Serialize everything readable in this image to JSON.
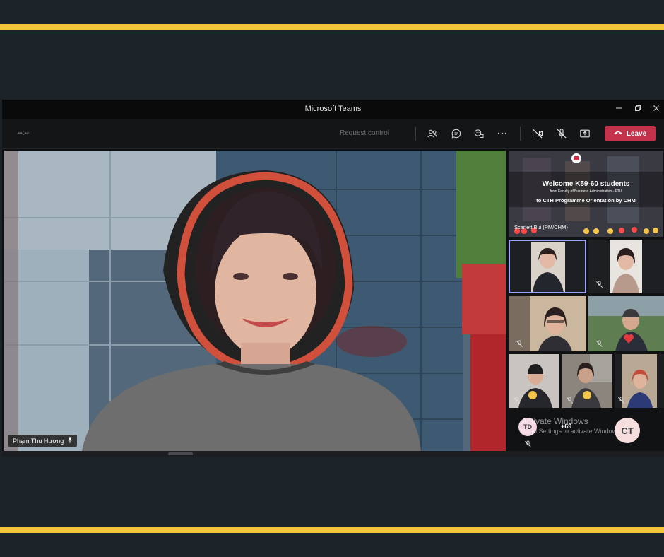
{
  "window": {
    "title": "Microsoft Teams"
  },
  "toolbar": {
    "timer": "--:--",
    "request_control": "Request control",
    "leave_label": "Leave",
    "leave_color": "#c4314b"
  },
  "stage": {
    "speaker_name": "Phạm Thu Hương"
  },
  "gallery": {
    "banner": {
      "title": "Welcome K59-60 students",
      "subtitle": "from Faculty of Business Administration - FTU",
      "line": "to CTH Programme Orientation by CHM",
      "presenter": "Scarlett Bui (PM/CHM)"
    },
    "avatars": [
      {
        "initials": "TD",
        "color": "#f3d6e3"
      },
      {
        "initials": "CT",
        "color": "#f6dede"
      }
    ],
    "overflow_count": "+69"
  },
  "watermark": {
    "title": "Activate Windows",
    "subtitle": "Go to Settings to activate Windows."
  },
  "icons": [
    "minimize-icon",
    "restore-icon",
    "close-icon",
    "participants-icon",
    "chat-icon",
    "reactions-icon",
    "more-icon",
    "camera-off-icon",
    "mic-off-icon",
    "share-icon",
    "phone-icon",
    "pin-icon"
  ]
}
